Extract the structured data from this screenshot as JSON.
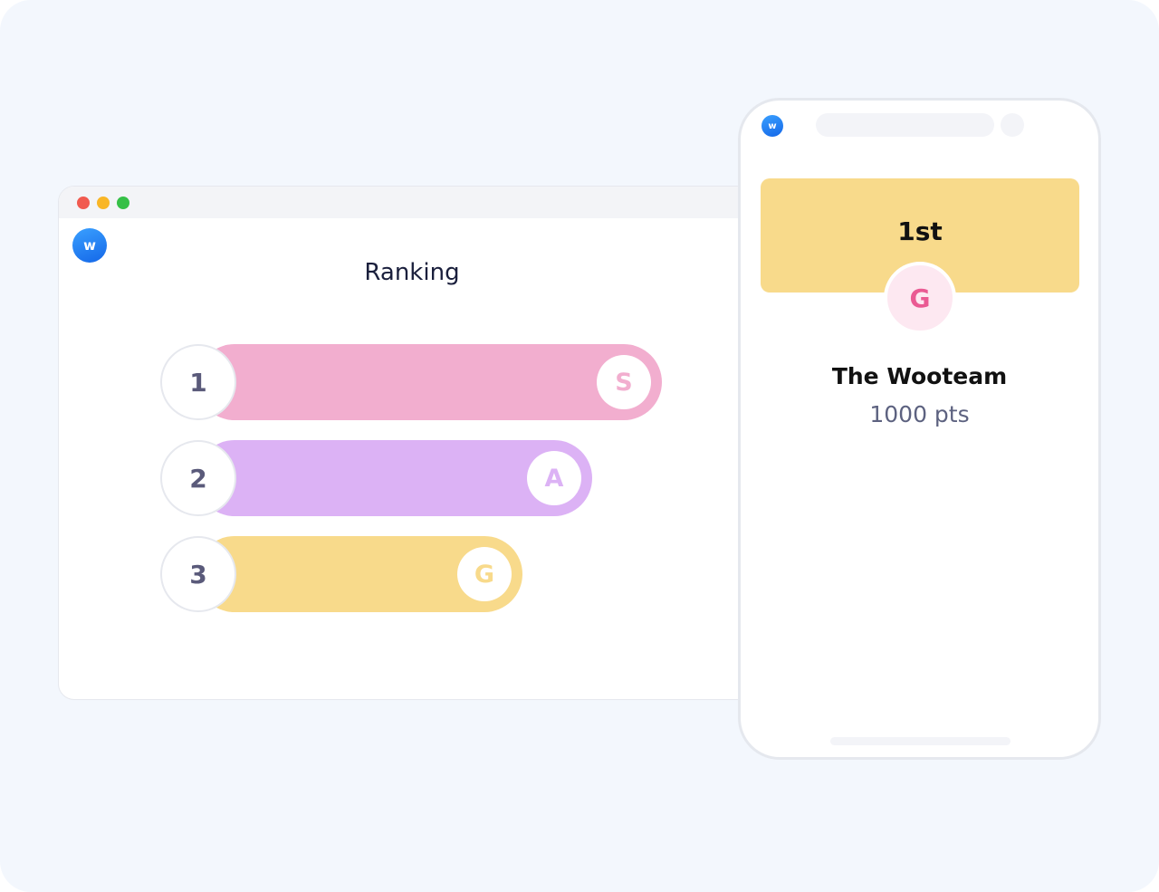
{
  "browser": {
    "logo_letter": "w",
    "title": "Ranking",
    "window_controls": {
      "close_color": "#f15a4f",
      "minimize_color": "#f9b626",
      "maximize_color": "#36c047"
    },
    "ranking": [
      {
        "rank": "1",
        "avatar": "S",
        "bar_color": "#f2aecf",
        "avatar_color": "#f2aecf",
        "relative_score": 1.0
      },
      {
        "rank": "2",
        "avatar": "A",
        "bar_color": "#dcb2f5",
        "avatar_color": "#dcb2f5",
        "relative_score": 0.85
      },
      {
        "rank": "3",
        "avatar": "G",
        "bar_color": "#f8da8b",
        "avatar_color": "#f8da8b",
        "relative_score": 0.7
      }
    ]
  },
  "phone": {
    "logo_letter": "w",
    "winner": {
      "place": "1st",
      "avatar": "G",
      "name": "The Wooteam",
      "points": "1000 pts",
      "card_color": "#f8da8b"
    }
  }
}
